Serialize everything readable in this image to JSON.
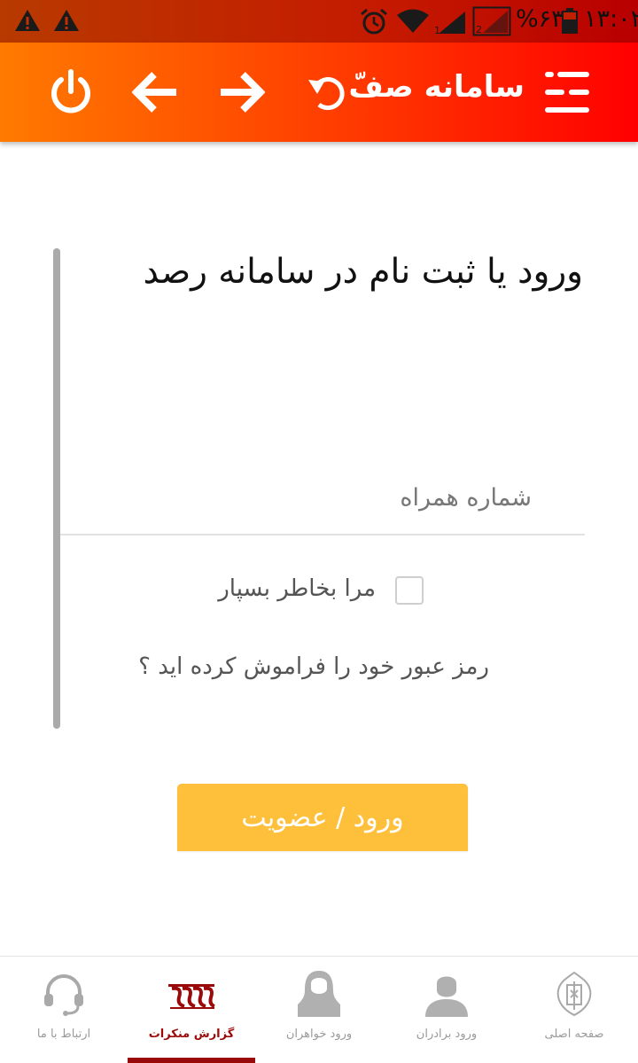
{
  "status_bar": {
    "battery_percent": "%۶۳",
    "time": "۱۳:۰۲"
  },
  "header": {
    "title": "سامانه صفّ",
    "icons": [
      "menu-icon",
      "refresh-icon",
      "forward-arrow-icon",
      "back-arrow-icon",
      "power-icon"
    ],
    "text_color": "#ffffff",
    "gradient": [
      "#ff7a00",
      "#ff0000"
    ]
  },
  "login": {
    "title": "ورود یا ثبت نام در سامانه رصد",
    "phone_placeholder": "شماره همراه",
    "remember_label": "مرا بخاطر بسپار",
    "remember_checked": false,
    "forgot_label": "رمز عبور خود را فراموش کرده اید ؟",
    "submit_label": "ورود / عضویت",
    "submit_color": "#fec03a"
  },
  "bottom_nav": {
    "items": [
      {
        "label": "صفحه اصلی",
        "icon": "emblem-icon"
      },
      {
        "label": "ورود برادران",
        "icon": "man-avatar-icon"
      },
      {
        "label": "ورود خواهران",
        "icon": "woman-avatar-icon"
      },
      {
        "label": "گزارش منکرات",
        "icon": "report-logo-icon"
      },
      {
        "label": "ارتباط با ما",
        "icon": "headset-icon"
      }
    ],
    "active_index": 3,
    "active_color": "#9b0a0a"
  }
}
